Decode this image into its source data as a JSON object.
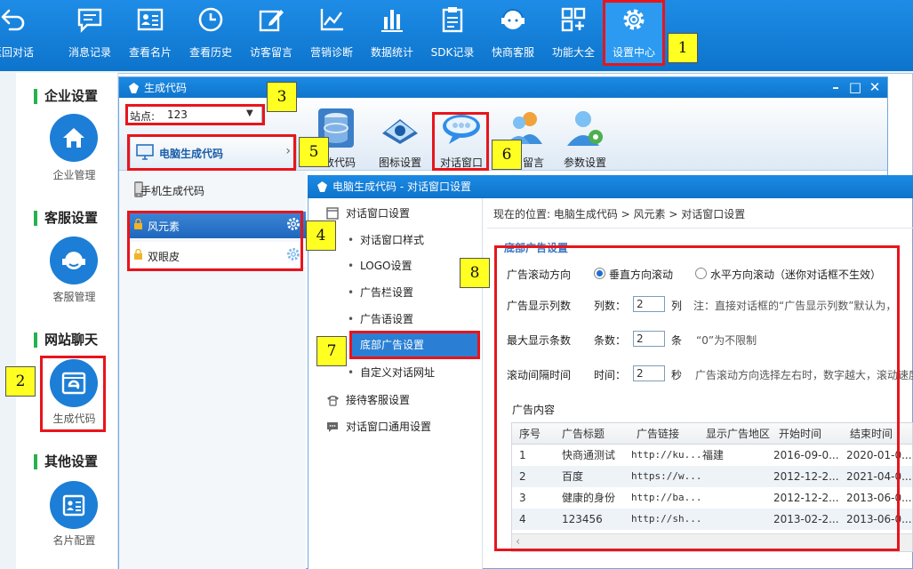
{
  "toolbar": {
    "items": [
      {
        "label": "返回对话",
        "icon": "back-arrow-icon"
      },
      {
        "label": "消息记录",
        "icon": "message-icon"
      },
      {
        "label": "查看名片",
        "icon": "card-icon"
      },
      {
        "label": "查看历史",
        "icon": "clock-icon"
      },
      {
        "label": "访客留言",
        "icon": "edit-icon"
      },
      {
        "label": "营销诊断",
        "icon": "chart-line-icon"
      },
      {
        "label": "数据统计",
        "icon": "bar-chart-icon"
      },
      {
        "label": "SDK记录",
        "icon": "clipboard-icon"
      },
      {
        "label": "快商客服",
        "icon": "headset-icon"
      },
      {
        "label": "功能大全",
        "icon": "grid-plus-icon"
      },
      {
        "label": "设置中心",
        "icon": "gear-icon"
      }
    ]
  },
  "left_nav": {
    "sections": [
      {
        "heading": "企业设置",
        "item": "企业管理",
        "icon": "home-icon"
      },
      {
        "heading": "客服设置",
        "item": "客服管理",
        "icon": "headset-icon"
      },
      {
        "heading": "网站聊天",
        "item": "生成代码",
        "icon": "browser-e-icon"
      },
      {
        "heading": "其他设置",
        "item": "名片配置",
        "icon": "id-card-icon"
      }
    ]
  },
  "gen_window": {
    "title": "生成代码",
    "site_label": "站点:",
    "site_value": "123",
    "tools": [
      {
        "label": "数代码",
        "icon": "database-icon"
      },
      {
        "label": "图标设置",
        "icon": "icon-settings-icon"
      },
      {
        "label": "对话窗口",
        "icon": "chat-bubble-icon"
      },
      {
        "label": "留言",
        "icon": "users-icon"
      },
      {
        "label": "参数设置",
        "icon": "user-gear-icon"
      }
    ],
    "pc_code": "电脑生成代码",
    "mobile_code": "手机生成代码",
    "skins": [
      "风元素",
      "双眼皮"
    ]
  },
  "dialog": {
    "title": "电脑生成代码 - 对话窗口设置",
    "menu": {
      "group1": "对话窗口设置",
      "subs": [
        "对话窗口样式",
        "LOGO设置",
        "广告栏设置",
        "广告语设置",
        "底部广告设置",
        "自定义对话网址"
      ],
      "group2": "接待客服设置",
      "group3": "对话窗口通用设置"
    },
    "breadcrumb": "现在的位置:  电脑生成代码 > 风元素 > 对话窗口设置",
    "section_title": "底部广告设置",
    "form": {
      "scroll_label": "广告滚动方向",
      "scroll_opt1": "垂直方向滚动",
      "scroll_opt2": "水平方向滚动（迷你对话框不生效）",
      "cols_label": "广告显示列数",
      "cols_prefix": "列数：",
      "cols_value": "2",
      "cols_unit": "列",
      "cols_note": "注：直接对话框的“广告显示列数”默认为，",
      "max_label": "最大显示条数",
      "max_prefix": "条数：",
      "max_value": "2",
      "max_unit": "条",
      "max_note": "“0”为不限制",
      "interval_label": "滚动间隔时间",
      "interval_prefix": "时间：",
      "interval_value": "2",
      "interval_unit": "秒",
      "interval_note": "广告滚动方向选择左右时，数字越大，滚动速度"
    },
    "ad_content_label": "广告内容",
    "table": {
      "headers": [
        "序号",
        "广告标题",
        "广告链接",
        "显示广告地区",
        "开始时间",
        "结束时间"
      ],
      "rows": [
        [
          "1",
          "快商通测试",
          "http://ku...",
          "福建",
          "2016-09-0...",
          "2020-01-0..."
        ],
        [
          "2",
          "百度",
          "https://w...",
          "",
          "2012-12-2...",
          "2021-04-0..."
        ],
        [
          "3",
          "健康的身份",
          "http://ba...",
          "",
          "2012-12-2...",
          "2013-06-0..."
        ],
        [
          "4",
          "123456",
          "http://sh...",
          "",
          "2013-02-2...",
          "2013-06-0..."
        ]
      ]
    }
  },
  "annotations": [
    "1",
    "2",
    "3",
    "4",
    "5",
    "6",
    "7",
    "8"
  ],
  "colors": {
    "toolbar": "#1480da",
    "highlight": "#e8141c",
    "tag": "#ffff22",
    "accent": "#2a7fd4"
  }
}
